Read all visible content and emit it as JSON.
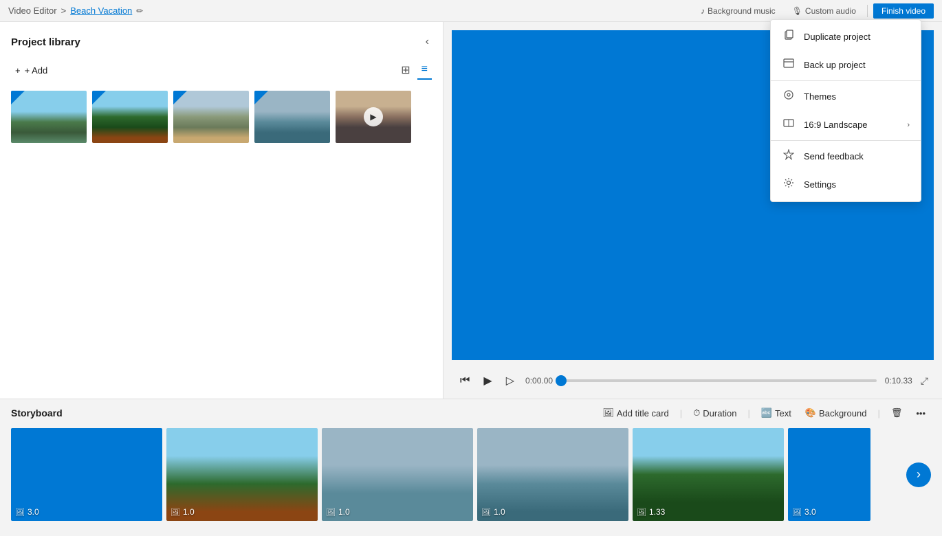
{
  "topbar": {
    "breadcrumb_home": "Video Editor",
    "breadcrumb_sep": ">",
    "breadcrumb_project": "Beach Vacation",
    "btn_background_music": "Background music",
    "btn_custom_audio": "Custom audio",
    "btn_finish_video": "Finish video"
  },
  "left_panel": {
    "title": "Project library",
    "add_label": "+ Add",
    "view_grid_label": "⊞",
    "view_list_label": "≡",
    "thumbnails": [
      {
        "id": 1,
        "has_badge": true,
        "has_play": false,
        "css_class": "thumb-1"
      },
      {
        "id": 2,
        "has_badge": true,
        "has_play": false,
        "css_class": "thumb-2"
      },
      {
        "id": 3,
        "has_badge": true,
        "has_play": false,
        "css_class": "thumb-3"
      },
      {
        "id": 4,
        "has_badge": true,
        "has_play": false,
        "css_class": "thumb-4"
      },
      {
        "id": 5,
        "has_badge": false,
        "has_play": true,
        "css_class": "thumb-5"
      }
    ]
  },
  "video_controls": {
    "time_current": "0:00.00",
    "time_total": "0:10.33",
    "progress_pct": 0
  },
  "storyboard": {
    "title": "Storyboard",
    "actions": {
      "add_title_card": "Add title card",
      "duration": "Duration",
      "text": "Text",
      "background": "Background"
    },
    "clips": [
      {
        "id": 1,
        "duration": "3.0",
        "css_class": "clip-1"
      },
      {
        "id": 2,
        "duration": "1.0",
        "css_class": "clip-2"
      },
      {
        "id": 3,
        "duration": "1.0",
        "css_class": "clip-3"
      },
      {
        "id": 4,
        "duration": "1.0",
        "css_class": "clip-4"
      },
      {
        "id": 5,
        "duration": "1.33",
        "css_class": "clip-5"
      },
      {
        "id": 6,
        "duration": "3.0",
        "css_class": "clip-6"
      }
    ]
  },
  "dropdown_menu": {
    "items": [
      {
        "id": "duplicate",
        "label": "Duplicate project",
        "icon": "⧉",
        "has_chevron": false
      },
      {
        "id": "backup",
        "label": "Back up project",
        "icon": "⊡",
        "has_chevron": false
      },
      {
        "id": "themes",
        "label": "Themes",
        "icon": "◎",
        "has_chevron": false
      },
      {
        "id": "landscape",
        "label": "16:9 Landscape",
        "icon": "▣",
        "has_chevron": true
      },
      {
        "id": "feedback",
        "label": "Send feedback",
        "icon": "⚑",
        "has_chevron": false
      },
      {
        "id": "settings",
        "label": "Settings",
        "icon": "⚙",
        "has_chevron": false
      }
    ]
  }
}
